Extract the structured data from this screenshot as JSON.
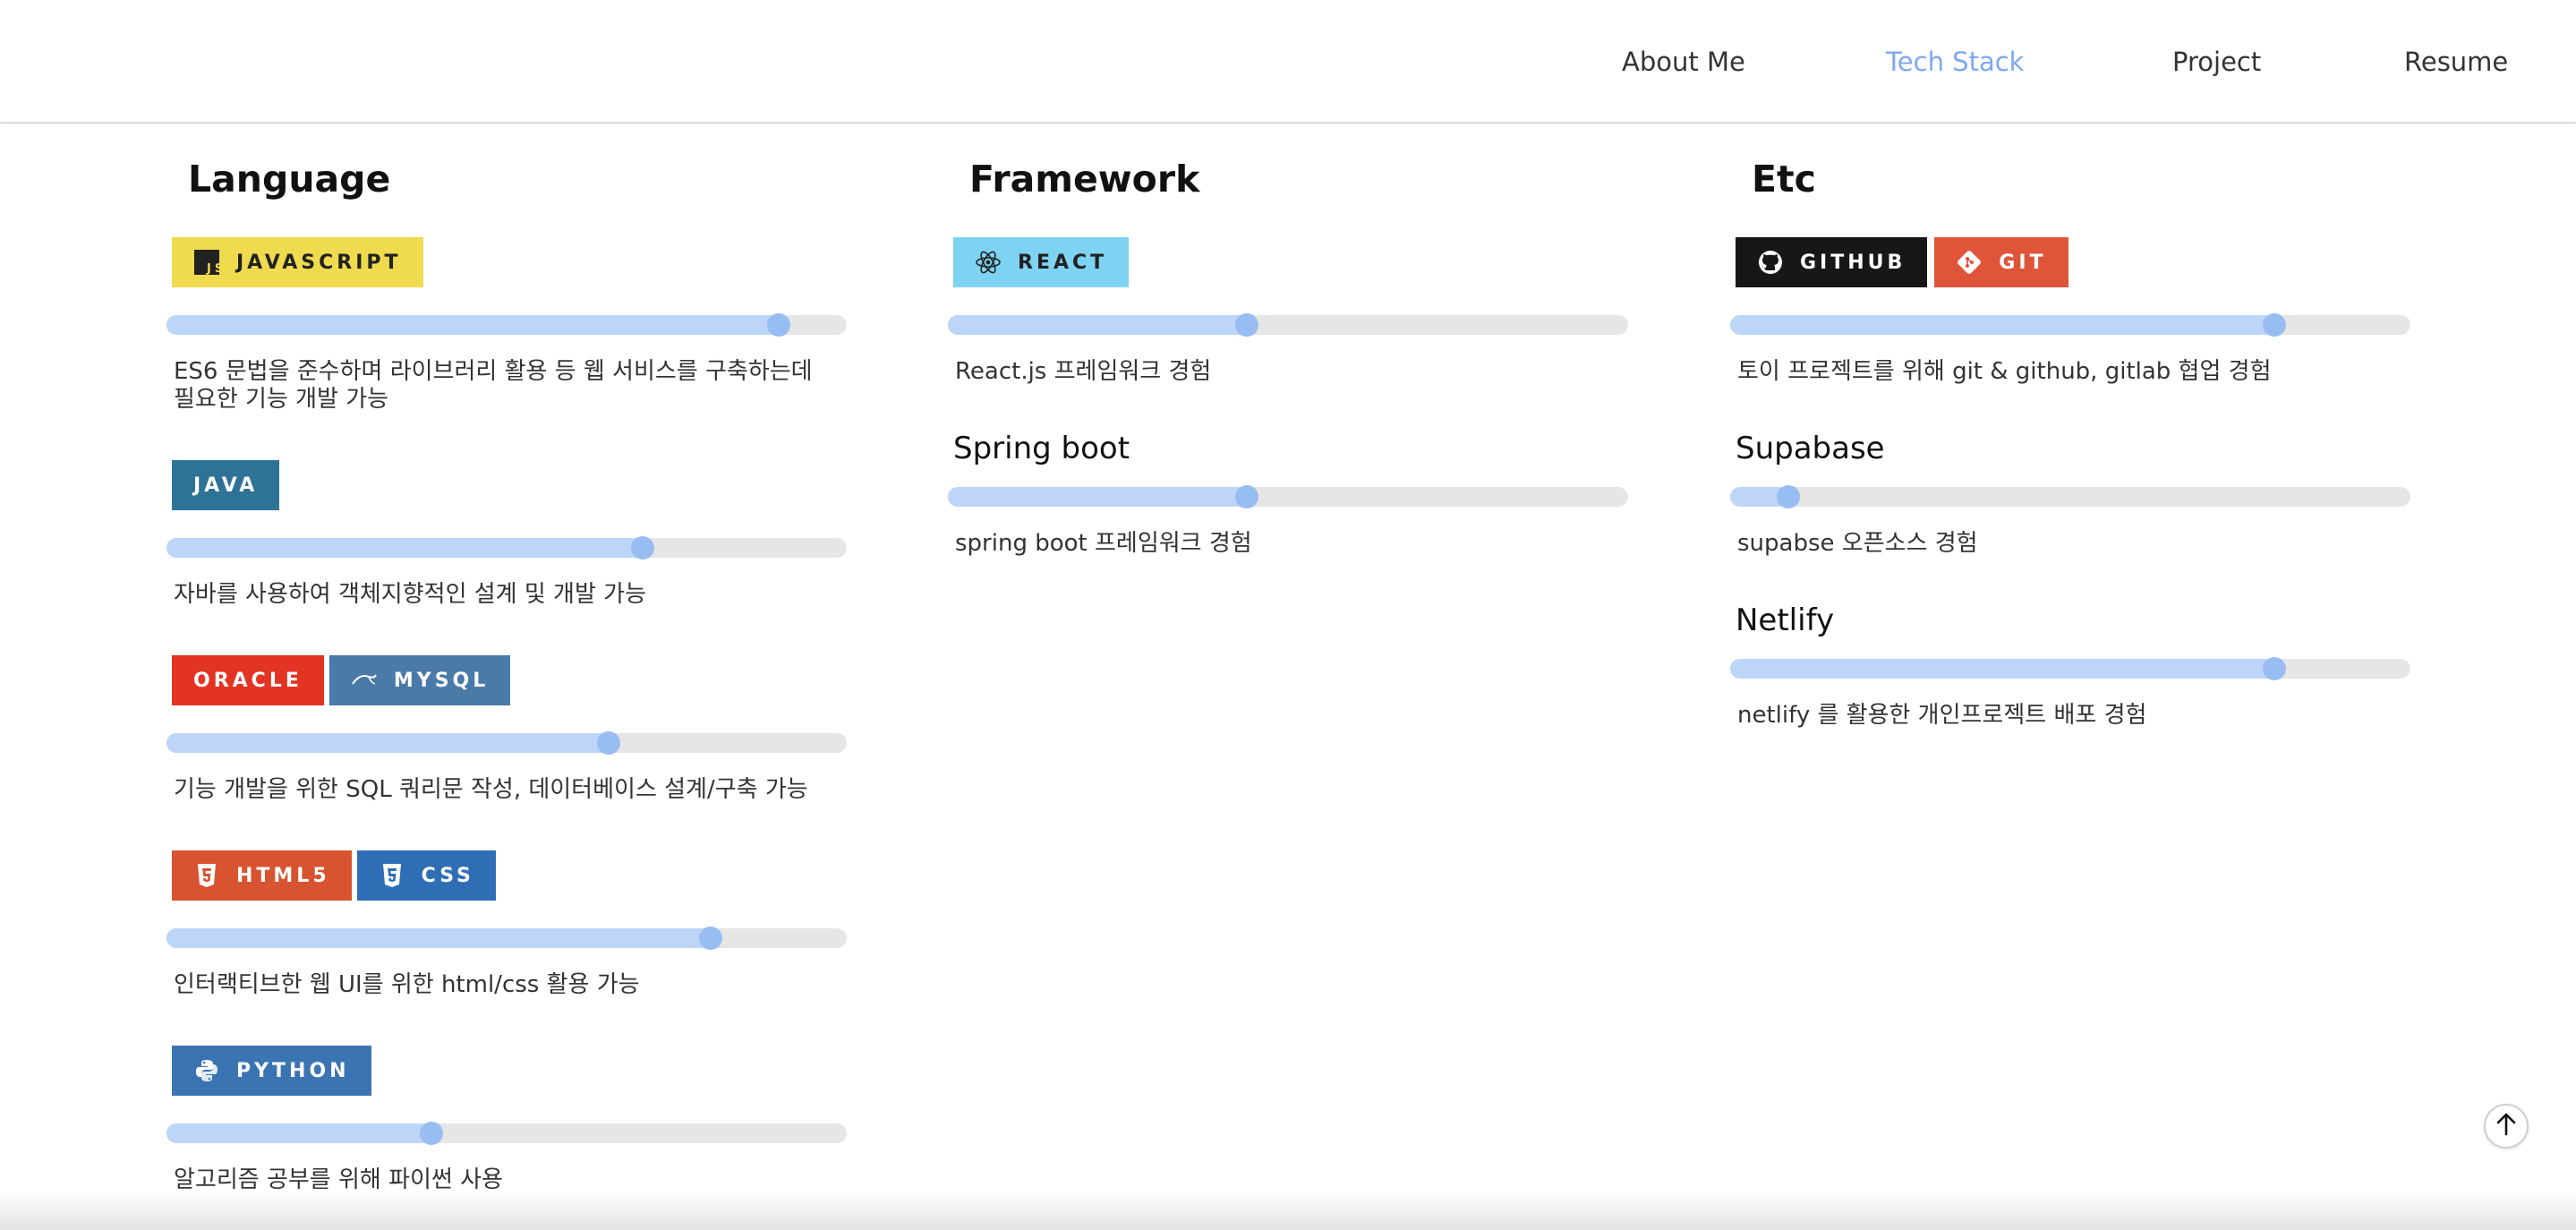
{
  "nav": {
    "items": [
      {
        "label": "About Me",
        "active": false
      },
      {
        "label": "Tech Stack",
        "active": true
      },
      {
        "label": "Project",
        "active": false
      },
      {
        "label": "Resume",
        "active": false
      }
    ],
    "active_color": "#7ea8f2"
  },
  "sections": {
    "language": {
      "title": "Language",
      "items": [
        {
          "badges": [
            {
              "label": "JAVASCRIPT",
              "icon": "javascript-icon",
              "bg": "#f0db4f",
              "fg": "#222222"
            }
          ],
          "level": 0.9,
          "desc": "ES6 문법을 준수하며 라이브러리 활용 등 웹 서비스를 구축하는데 필요한 기능 개발 가능"
        },
        {
          "badges": [
            {
              "label": "JAVA",
              "icon": "",
              "bg": "#2e7296",
              "fg": "#ffffff"
            }
          ],
          "level": 0.7,
          "desc": "자바를 사용하여 객체지향적인 설계 및 개발 가능"
        },
        {
          "badges": [
            {
              "label": "ORACLE",
              "icon": "",
              "bg": "#e33323",
              "fg": "#ffffff"
            },
            {
              "label": "MYSQL",
              "icon": "mysql-icon",
              "bg": "#4a7aa8",
              "fg": "#ffffff"
            }
          ],
          "level": 0.65,
          "desc": "기능 개발을 위한 SQL 쿼리문 작성, 데이터베이스 설계/구축 가능"
        },
        {
          "badges": [
            {
              "label": "HTML5",
              "icon": "html5-icon",
              "bg": "#d8532f",
              "fg": "#ffffff"
            },
            {
              "label": "CSS",
              "icon": "css3-icon",
              "bg": "#2f6eb5",
              "fg": "#ffffff"
            }
          ],
          "level": 0.8,
          "desc": "인터랙티브한 웹 UI를 위한 html/css 활용 가능"
        },
        {
          "badges": [
            {
              "label": "PYTHON",
              "icon": "python-icon",
              "bg": "#3a74b3",
              "fg": "#ffffff"
            }
          ],
          "level": 0.39,
          "desc": "알고리즘 공부를 위해 파이썬 사용"
        }
      ]
    },
    "framework": {
      "title": "Framework",
      "items": [
        {
          "badges": [
            {
              "label": "REACT",
              "icon": "react-icon",
              "bg": "#7fd3f2",
              "fg": "#222222"
            }
          ],
          "level": 0.44,
          "desc": "React.js 프레임워크 경험"
        },
        {
          "subtitle": "Spring boot",
          "level": 0.44,
          "desc": "spring boot 프레임워크 경험"
        }
      ]
    },
    "etc": {
      "title": "Etc",
      "items": [
        {
          "badges": [
            {
              "label": "GITHUB",
              "icon": "github-icon",
              "bg": "#171717",
              "fg": "#ffffff"
            },
            {
              "label": "GIT",
              "icon": "git-icon",
              "bg": "#e0553a",
              "fg": "#ffffff"
            }
          ],
          "level": 0.8,
          "desc": "토이 프로젝트를 위해 git & github, gitlab 협업 경험"
        },
        {
          "subtitle": "Supabase",
          "level": 0.085,
          "desc": "supabse 오픈소스 경험"
        },
        {
          "subtitle": "Netlify",
          "level": 0.8,
          "desc": "netlify 를 활용한 개인프로젝트 배포 경험"
        }
      ]
    }
  },
  "colors": {
    "bar_track": "#e6e6e6",
    "bar_fill": "#bcd5f8",
    "bar_knob": "#98bdf3"
  },
  "scroll_top_icon": "arrow-up-icon"
}
